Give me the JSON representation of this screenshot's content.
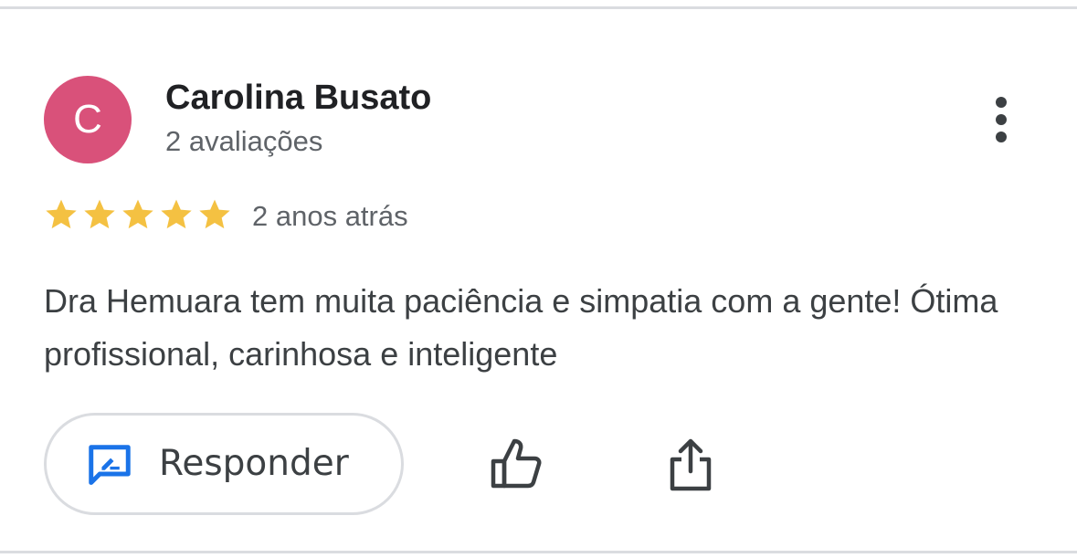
{
  "review": {
    "author": {
      "initial": "C",
      "name": "Carolina Busato",
      "review_count": "2 avaliações",
      "avatar_color": "#d9517a"
    },
    "rating": 5,
    "rating_max": 5,
    "star_color": "#f4c142",
    "date": "2 anos atrás",
    "text": "Dra Hemuara tem muita paciência e simpatia com a gente! Ótima profissional, carinhosa e inteligente"
  },
  "actions": {
    "reply_label": "Responder",
    "reply_icon": "rate-review-icon",
    "like_icon": "thumb-up-icon",
    "share_icon": "share-icon",
    "more_icon": "more-vert-icon",
    "accent_color": "#1a73e8"
  }
}
